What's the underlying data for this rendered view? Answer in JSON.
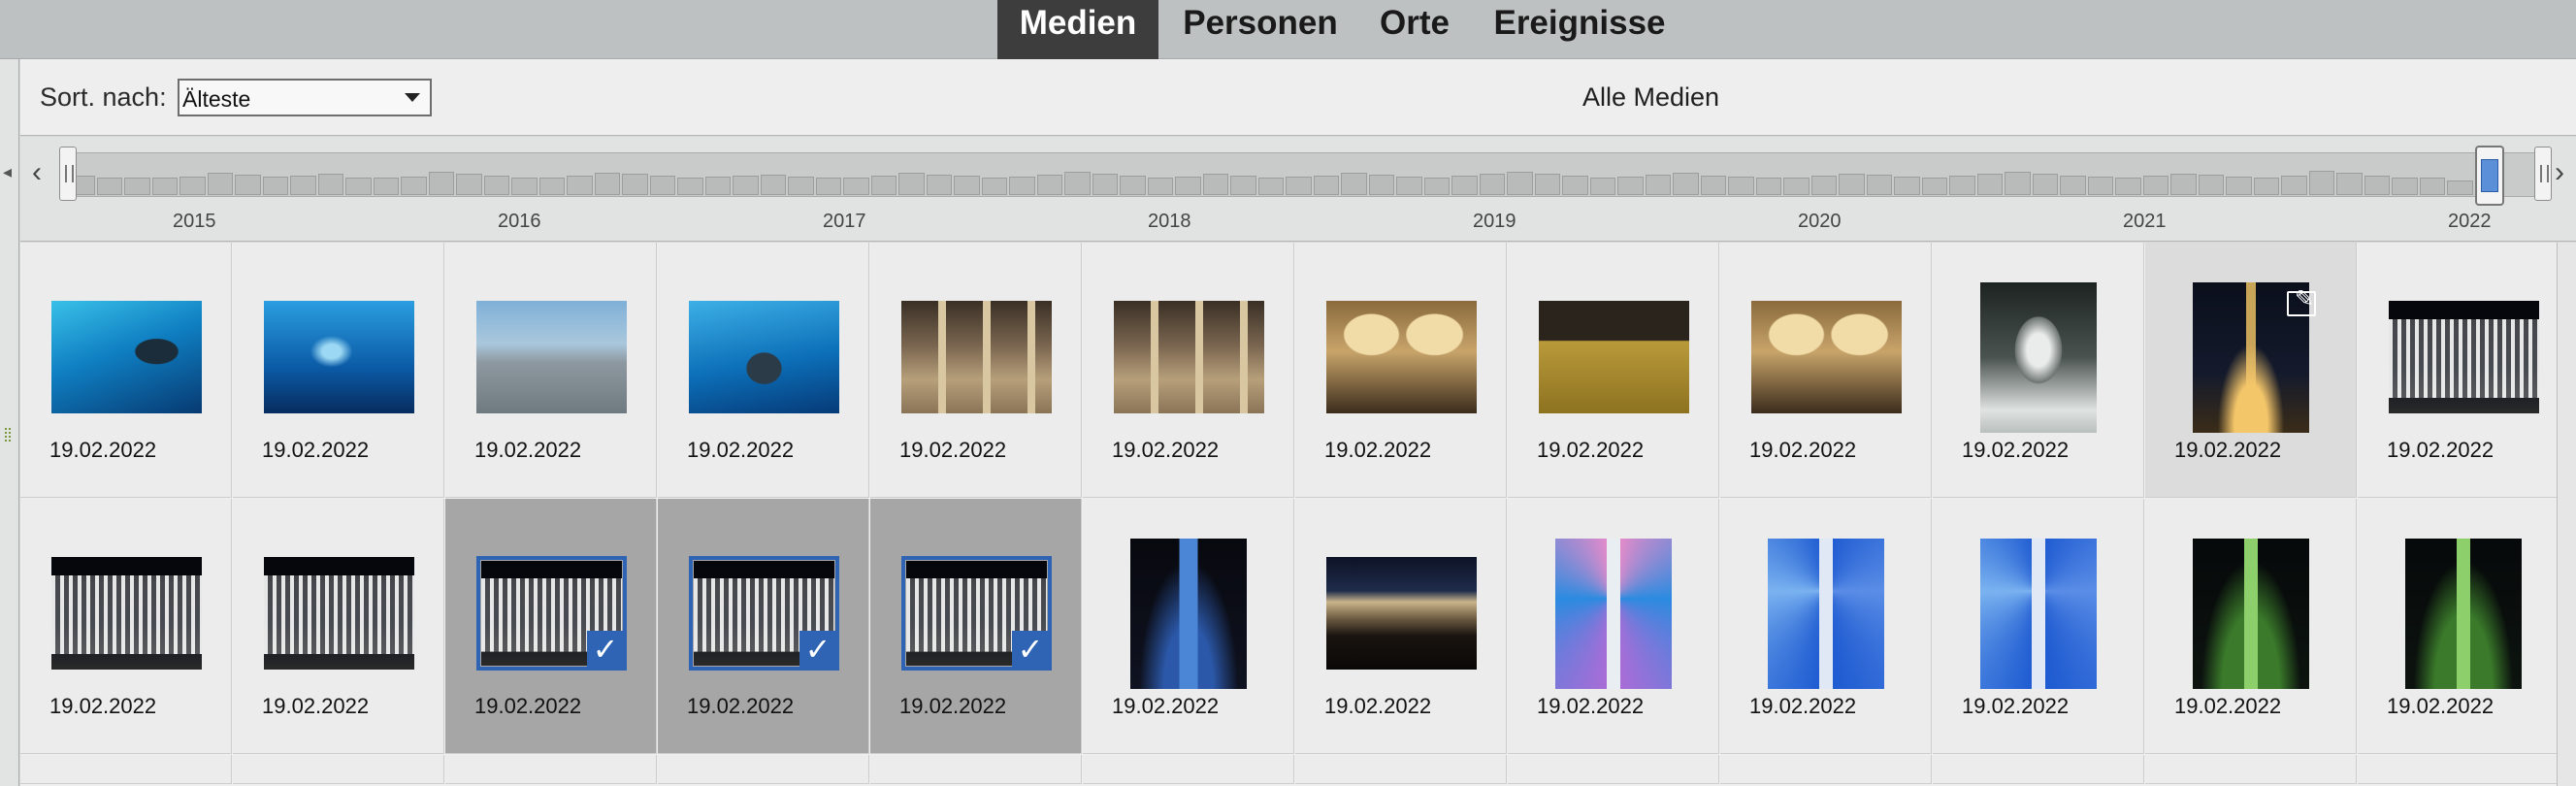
{
  "tabs": [
    {
      "label": "Medien",
      "active": true
    },
    {
      "label": "Personen",
      "active": false
    },
    {
      "label": "Orte",
      "active": false
    },
    {
      "label": "Ereignisse",
      "active": false
    }
  ],
  "sort": {
    "label": "Sort. nach:",
    "value": "Älteste"
  },
  "view_title": "Alle Medien",
  "timeline": {
    "years": [
      "2015",
      "2016",
      "2017",
      "2018",
      "2019",
      "2020",
      "2021",
      "2022"
    ],
    "histogram_levels": [
      0.5,
      0.46,
      0.44,
      0.45,
      0.48,
      0.58,
      0.52,
      0.47,
      0.5,
      0.54,
      0.46,
      0.44,
      0.48,
      0.6,
      0.55,
      0.5,
      0.46,
      0.44,
      0.5,
      0.57,
      0.54,
      0.49,
      0.45,
      0.47,
      0.5,
      0.52,
      0.48,
      0.44,
      0.46,
      0.5,
      0.58,
      0.53,
      0.49,
      0.45,
      0.47,
      0.52,
      0.6,
      0.55,
      0.5,
      0.46,
      0.48,
      0.54,
      0.5,
      0.45,
      0.47,
      0.5,
      0.57,
      0.52,
      0.48,
      0.45,
      0.5,
      0.55,
      0.6,
      0.54,
      0.49,
      0.46,
      0.48,
      0.53,
      0.58,
      0.51,
      0.47,
      0.44,
      0.46,
      0.5,
      0.56,
      0.52,
      0.48,
      0.45,
      0.5,
      0.54,
      0.6,
      0.55,
      0.5,
      0.47,
      0.45,
      0.49,
      0.56,
      0.52,
      0.47,
      0.45,
      0.5,
      0.62,
      0.57,
      0.5,
      0.46,
      0.44,
      0.38
    ]
  },
  "grid": {
    "items": [
      {
        "date": "19.02.2022",
        "kind": "aquarium-tunnel-selfie",
        "orient": "land",
        "state": "normal"
      },
      {
        "date": "19.02.2022",
        "kind": "aquarium-shark",
        "orient": "land",
        "state": "normal"
      },
      {
        "date": "19.02.2022",
        "kind": "city-skyline-aerial",
        "orient": "land",
        "state": "normal"
      },
      {
        "date": "19.02.2022",
        "kind": "aquarium-selfie",
        "orient": "land",
        "state": "normal"
      },
      {
        "date": "19.02.2022",
        "kind": "mall-hall",
        "orient": "land",
        "state": "normal"
      },
      {
        "date": "19.02.2022",
        "kind": "mall-hall",
        "orient": "land",
        "state": "normal"
      },
      {
        "date": "19.02.2022",
        "kind": "gold-souk-arches",
        "orient": "land",
        "state": "normal"
      },
      {
        "date": "19.02.2022",
        "kind": "info-sign",
        "orient": "land",
        "state": "normal"
      },
      {
        "date": "19.02.2022",
        "kind": "gold-souk-arches",
        "orient": "land",
        "state": "normal"
      },
      {
        "date": "19.02.2022",
        "kind": "jewelry-display",
        "orient": "port",
        "state": "normal"
      },
      {
        "date": "19.02.2022",
        "kind": "burj-night",
        "orient": "port",
        "state": "hover",
        "editable": true
      },
      {
        "date": "19.02.2022",
        "kind": "fountain-night",
        "orient": "land",
        "state": "normal"
      },
      {
        "date": "19.02.2022",
        "kind": "fountain-night",
        "orient": "land",
        "state": "normal"
      },
      {
        "date": "19.02.2022",
        "kind": "fountain-night",
        "orient": "land",
        "state": "normal"
      },
      {
        "date": "19.02.2022",
        "kind": "fountain-night",
        "orient": "land",
        "state": "selected"
      },
      {
        "date": "19.02.2022",
        "kind": "fountain-night",
        "orient": "land",
        "state": "selected"
      },
      {
        "date": "19.02.2022",
        "kind": "fountain-night",
        "orient": "land",
        "state": "selected"
      },
      {
        "date": "19.02.2022",
        "kind": "burj-blue",
        "orient": "port",
        "state": "normal"
      },
      {
        "date": "19.02.2022",
        "kind": "crowd-night",
        "orient": "land",
        "state": "normal"
      },
      {
        "date": "19.02.2022",
        "kind": "burj-laser",
        "orient": "port",
        "state": "normal"
      },
      {
        "date": "19.02.2022",
        "kind": "burj-laser-blue",
        "orient": "port",
        "state": "normal"
      },
      {
        "date": "19.02.2022",
        "kind": "burj-laser-blue",
        "orient": "port",
        "state": "normal"
      },
      {
        "date": "19.02.2022",
        "kind": "burj-green",
        "orient": "port",
        "state": "normal"
      },
      {
        "date": "19.02.2022",
        "kind": "burj-green",
        "orient": "port",
        "state": "normal"
      }
    ]
  },
  "icons": {
    "check": "checkmark-icon",
    "edit": "edit-icon",
    "play": "play-next-icon"
  },
  "colors": {
    "accent": "#2f63b4",
    "active_tab": "#3d3d3d",
    "selected_cell": "#a6a6a6"
  }
}
